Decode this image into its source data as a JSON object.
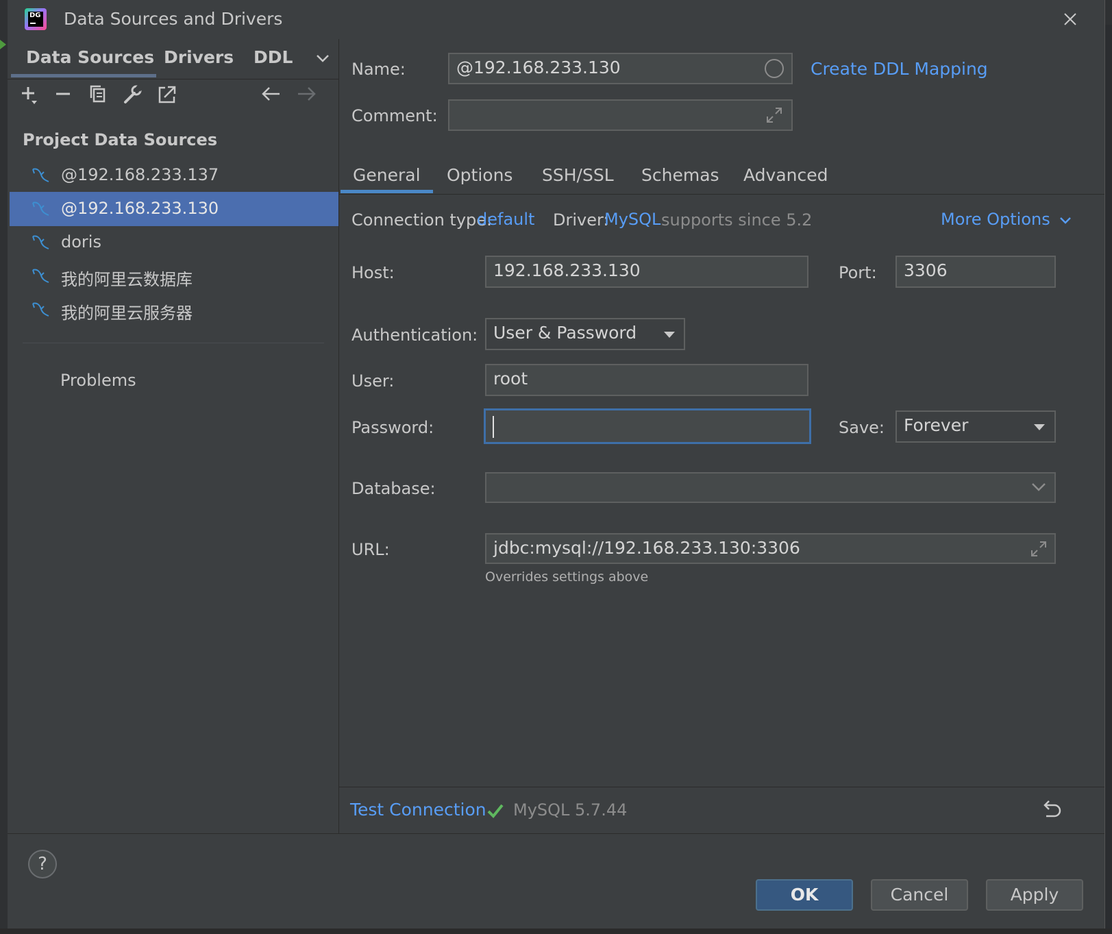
{
  "window": {
    "title": "Data Sources and Drivers"
  },
  "left_tabs": [
    "Data Sources",
    "Drivers",
    "DDL"
  ],
  "section_title": "Project Data Sources",
  "data_sources": [
    {
      "label": "@192.168.233.137",
      "selected": false
    },
    {
      "label": "@192.168.233.130",
      "selected": true
    },
    {
      "label": "doris",
      "selected": false
    },
    {
      "label": "我的阿里云数据库",
      "selected": false
    },
    {
      "label": "我的阿里云服务器",
      "selected": false
    }
  ],
  "problems_label": "Problems",
  "form": {
    "name_label": "Name:",
    "name_value": "@192.168.233.130",
    "create_ddl_link": "Create DDL Mapping",
    "comment_label": "Comment:",
    "comment_value": ""
  },
  "tabs": [
    "General",
    "Options",
    "SSH/SSL",
    "Schemas",
    "Advanced"
  ],
  "active_tab": "General",
  "general": {
    "connection_type_label": "Connection type:",
    "connection_type_value": "default",
    "driver_label": "Driver:",
    "driver_value": "MySQL",
    "driver_note": "supports since 5.2",
    "more_options": "More Options",
    "host_label": "Host:",
    "host_value": "192.168.233.130",
    "port_label": "Port:",
    "port_value": "3306",
    "auth_label": "Authentication:",
    "auth_value": "User & Password",
    "user_label": "User:",
    "user_value": "root",
    "password_label": "Password:",
    "password_value": "",
    "save_label": "Save:",
    "save_value": "Forever",
    "database_label": "Database:",
    "database_value": "",
    "url_label": "URL:",
    "url_value": "jdbc:mysql://192.168.233.130:3306",
    "url_hint": "Overrides settings above"
  },
  "test": {
    "link": "Test Connection",
    "status": "MySQL 5.7.44"
  },
  "buttons": {
    "ok": "OK",
    "cancel": "Cancel",
    "apply": "Apply",
    "help": "?"
  },
  "colors": {
    "accent": "#589df6",
    "selection": "#4b6eaf",
    "success": "#5fb85f",
    "background": "#3c3f41"
  },
  "icons": [
    "add-icon",
    "remove-icon",
    "duplicate-icon",
    "wrench-icon",
    "open-external-icon",
    "back-arrow-icon",
    "forward-arrow-icon",
    "mysql-dolphin-icon",
    "expand-icon",
    "chevron-down-icon",
    "check-icon",
    "undo-icon",
    "close-icon"
  ]
}
